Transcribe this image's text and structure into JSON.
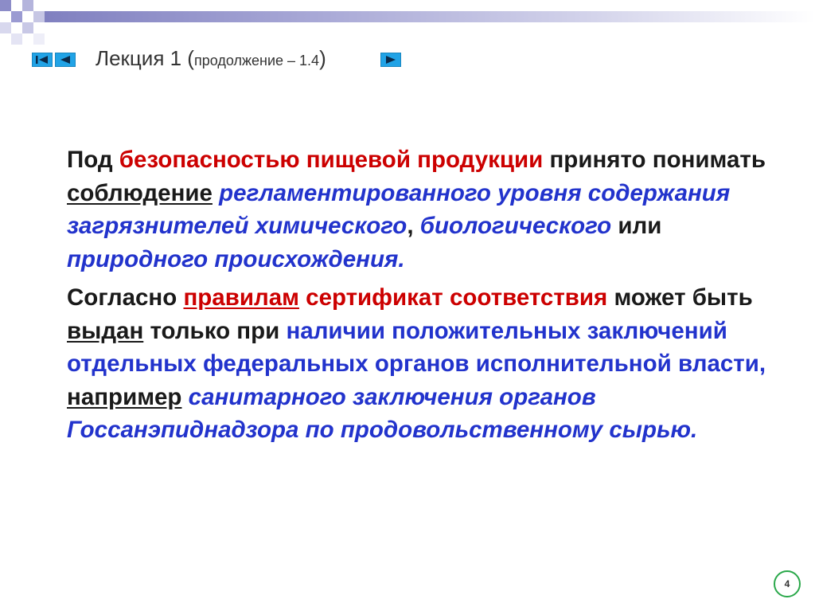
{
  "nav": {
    "first_icon": "skip-to-first-icon",
    "prev_icon": "previous-arrow-icon",
    "next_icon": "next-arrow-icon",
    "accent_color": "#21a3e6"
  },
  "title": {
    "main": "Лекция 1 (",
    "sub": "продолжение – 1.4",
    "close": ")"
  },
  "paragraph1": {
    "s1": "Под ",
    "s2": "безопасностью пищевой продукции",
    "s3": " принято понимать ",
    "s4": "соблюдение",
    "s5": " ",
    "s6": "регламентированного уровня содержания загрязнителей химического",
    "s7": ", ",
    "s8": "биологического",
    "s9": " или ",
    "s10": "природного происхождения."
  },
  "paragraph2": {
    "s1": "Согласно ",
    "s2": "правилам",
    "s3": " ",
    "s4": "сертификат соответствия",
    "s5": " может быть ",
    "s6": "выдан",
    "s7": " только при ",
    "s8": "наличии положительных заключений отдельных федеральных органов исполнительной власти,",
    "s9": " ",
    "s10": "например",
    "s11": " ",
    "s12": "санитарного заключения органов Госсанэпиднадзора по продовольственному сырью."
  },
  "page_number": "4",
  "colors": {
    "red_emphasis": "#cc0000",
    "blue_emphasis": "#2233cc",
    "page_circle": "#2aa84a"
  }
}
